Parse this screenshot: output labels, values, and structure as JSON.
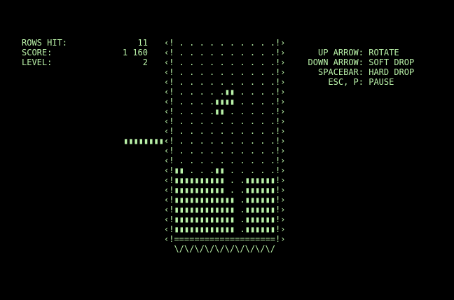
{
  "stats": [
    {
      "label": "ROWS HIT:",
      "value": "11"
    },
    {
      "label": "SCORE:",
      "value": "1 160"
    },
    {
      "label": "LEVEL:",
      "value": "2"
    }
  ],
  "controls": [
    {
      "key": "UP ARROW:",
      "action": "ROTATE"
    },
    {
      "key": "DOWN ARROW:",
      "action": "SOFT DROP"
    },
    {
      "key": "SPACEBAR:",
      "action": "HARD DROP"
    },
    {
      "key": "ESC, P:",
      "action": "PAUSE"
    }
  ],
  "well_rows": [
    "‹! . . . . . . . . . .!›",
    "‹! . . . . . . . . . .!›",
    "‹! . . . . . . . . . .!›",
    "‹! . . . . . . . . . .!›",
    "‹! . . . . . . . . . .!›",
    "‹! . . . . .▮▮ . . . .!›",
    "‹! . . . .▮▮▮▮ . . . .!›",
    "‹! . . . .▮▮ . . . . .!›",
    "‹! . . . . . . . . . .!›",
    "‹! . . . . . . . . . .!›",
    "‹! . . . . . . . . . .!›",
    "‹! . . . . . . . . . .!›",
    "‹! . . . . . . . . . .!›",
    "‹!▮▮ . . .▮▮ . . . . .!›",
    "‹!▮▮▮▮▮▮▮▮▮▮ . .▮▮▮▮▮▮!›",
    "‹!▮▮▮▮▮▮▮▮▮▮ . .▮▮▮▮▮▮!›",
    "‹!▮▮▮▮▮▮▮▮▮▮▮▮ .▮▮▮▮▮▮!›",
    "‹!▮▮▮▮▮▮▮▮▮▮▮▮ .▮▮▮▮▮▮!›",
    "‹!▮▮▮▮▮▮▮▮▮▮▮▮ .▮▮▮▮▮▮!›",
    "‹!▮▮▮▮▮▮▮▮▮▮▮▮ .▮▮▮▮▮▮!›",
    "‹!====================!›",
    "  \\/\\/\\/\\/\\/\\/\\/\\/\\/\\/"
  ],
  "next_piece": "▮▮▮▮▮▮▮▮‹",
  "colors": {
    "foreground": "#b9f2a8",
    "background": "#000000"
  }
}
